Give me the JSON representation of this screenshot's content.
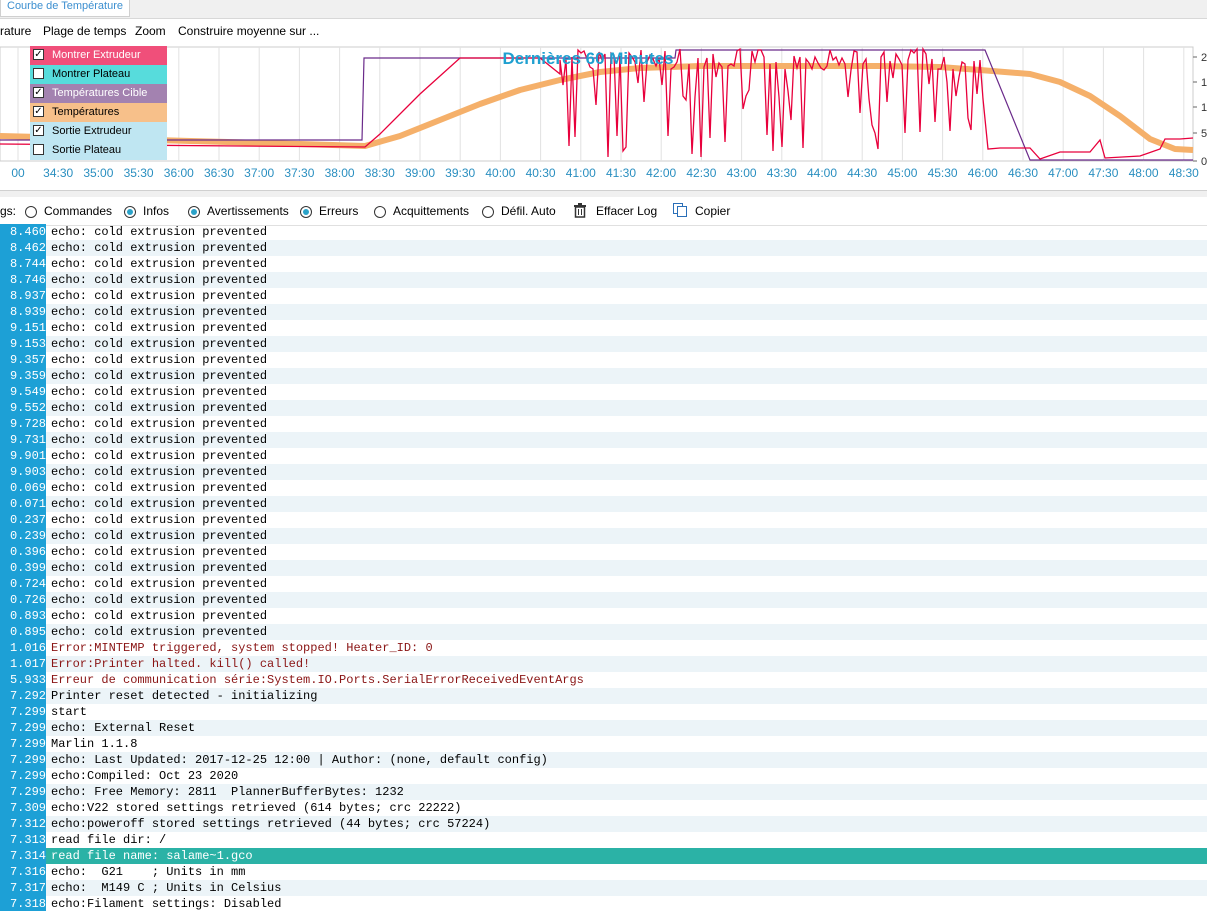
{
  "tab": {
    "label": "Courbe de Température"
  },
  "menu": {
    "items": [
      "rature",
      "Plage de temps",
      "Zoom",
      "Construire moyenne sur ..."
    ]
  },
  "chart": {
    "title": "Dernières 60 Minutes",
    "legend": [
      {
        "label": "Montrer Extrudeur",
        "checked": true,
        "color": "#f04f7a"
      },
      {
        "label": "Montrer Plateau",
        "checked": false,
        "color": "#57dcdc"
      },
      {
        "label": "Températures Cible",
        "checked": true,
        "color": "#a382b0"
      },
      {
        "label": "Températures",
        "checked": true,
        "color": "#f7c08a"
      },
      {
        "label": "Sortie Extrudeur",
        "checked": true,
        "color": "#bfe6f2"
      },
      {
        "label": "Sortie Plateau",
        "checked": false,
        "color": "#bfe6f2"
      }
    ],
    "check_glyph": "✓",
    "y_ticks": [
      "2",
      "1",
      "1",
      "5",
      "0"
    ]
  },
  "chart_data": {
    "type": "line",
    "title": "Dernières 60 Minutes",
    "x_ticks": [
      "00",
      "34:30",
      "35:00",
      "35:30",
      "36:00",
      "36:30",
      "37:00",
      "37:30",
      "38:00",
      "38:30",
      "39:00",
      "39:30",
      "40:00",
      "40:30",
      "41:00",
      "41:30",
      "42:00",
      "42:30",
      "43:00",
      "43:30",
      "44:00",
      "44:30",
      "45:00",
      "45:30",
      "46:00",
      "46:30",
      "47:00",
      "47:30",
      "48:00",
      "48:30"
    ],
    "y_ticks": [
      "2",
      "1",
      "1",
      "5",
      "0"
    ],
    "series_colors": {
      "temperature": "#f5b06a",
      "extruder": "#e8003c",
      "target": "#6a2a8a"
    }
  },
  "filter": {
    "prefix": "gs:",
    "items": [
      {
        "label": "Commandes",
        "checked": false
      },
      {
        "label": "Infos",
        "checked": true
      },
      {
        "label": "Avertissements",
        "checked": true
      },
      {
        "label": "Erreurs",
        "checked": true
      },
      {
        "label": "Acquittements",
        "checked": false
      },
      {
        "label": "Défil. Auto",
        "checked": false
      }
    ],
    "clear_label": "Effacer Log",
    "copy_label": "Copier"
  },
  "log": [
    {
      "t": "8.460",
      "m": "echo: cold extrusion prevented"
    },
    {
      "t": "8.462",
      "m": "echo: cold extrusion prevented"
    },
    {
      "t": "8.744",
      "m": "echo: cold extrusion prevented"
    },
    {
      "t": "8.746",
      "m": "echo: cold extrusion prevented"
    },
    {
      "t": "8.937",
      "m": "echo: cold extrusion prevented"
    },
    {
      "t": "8.939",
      "m": "echo: cold extrusion prevented"
    },
    {
      "t": "9.151",
      "m": "echo: cold extrusion prevented"
    },
    {
      "t": "9.153",
      "m": "echo: cold extrusion prevented"
    },
    {
      "t": "9.357",
      "m": "echo: cold extrusion prevented"
    },
    {
      "t": "9.359",
      "m": "echo: cold extrusion prevented"
    },
    {
      "t": "9.549",
      "m": "echo: cold extrusion prevented"
    },
    {
      "t": "9.552",
      "m": "echo: cold extrusion prevented"
    },
    {
      "t": "9.728",
      "m": "echo: cold extrusion prevented"
    },
    {
      "t": "9.731",
      "m": "echo: cold extrusion prevented"
    },
    {
      "t": "9.901",
      "m": "echo: cold extrusion prevented"
    },
    {
      "t": "9.903",
      "m": "echo: cold extrusion prevented"
    },
    {
      "t": "0.069",
      "m": "echo: cold extrusion prevented"
    },
    {
      "t": "0.071",
      "m": "echo: cold extrusion prevented"
    },
    {
      "t": "0.237",
      "m": "echo: cold extrusion prevented"
    },
    {
      "t": "0.239",
      "m": "echo: cold extrusion prevented"
    },
    {
      "t": "0.396",
      "m": "echo: cold extrusion prevented"
    },
    {
      "t": "0.399",
      "m": "echo: cold extrusion prevented"
    },
    {
      "t": "0.724",
      "m": "echo: cold extrusion prevented"
    },
    {
      "t": "0.726",
      "m": "echo: cold extrusion prevented"
    },
    {
      "t": "0.893",
      "m": "echo: cold extrusion prevented"
    },
    {
      "t": "0.895",
      "m": "echo: cold extrusion prevented"
    },
    {
      "t": "1.016",
      "m": "Error:MINTEMP triggered, system stopped! Heater_ID: 0",
      "type": "err"
    },
    {
      "t": "1.017",
      "m": "Error:Printer halted. kill() called!",
      "type": "err"
    },
    {
      "t": "5.933",
      "m": "Erreur de communication série:System.IO.Ports.SerialErrorReceivedEventArgs",
      "type": "err"
    },
    {
      "t": "7.292",
      "m": "Printer reset detected - initializing"
    },
    {
      "t": "7.299",
      "m": "start"
    },
    {
      "t": "7.299",
      "m": "echo: External Reset"
    },
    {
      "t": "7.299",
      "m": "Marlin 1.1.8"
    },
    {
      "t": "7.299",
      "m": "echo: Last Updated: 2017-12-25 12:00 | Author: (none, default config)"
    },
    {
      "t": "7.299",
      "m": "echo:Compiled: Oct 23 2020"
    },
    {
      "t": "7.299",
      "m": "echo: Free Memory: 2811  PlannerBufferBytes: 1232"
    },
    {
      "t": "7.309",
      "m": "echo:V22 stored settings retrieved (614 bytes; crc 22222)"
    },
    {
      "t": "7.312",
      "m": "echo:poweroff stored settings retrieved (44 bytes; crc 57224)"
    },
    {
      "t": "7.313",
      "m": "read file dir: /"
    },
    {
      "t": "7.314",
      "m": "read file name: salame~1.gco",
      "type": "sel"
    },
    {
      "t": "7.316",
      "m": "echo:  G21    ; Units in mm"
    },
    {
      "t": "7.317",
      "m": "echo:  M149 C ; Units in Celsius"
    },
    {
      "t": "7.318",
      "m": "echo:Filament settings: Disabled"
    }
  ]
}
